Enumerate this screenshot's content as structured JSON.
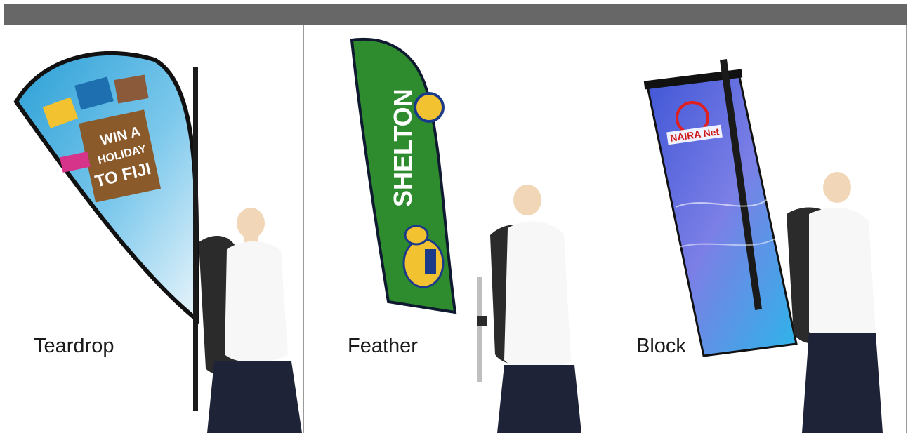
{
  "panels": [
    {
      "caption": "Teardrop"
    },
    {
      "caption": "Feather"
    },
    {
      "caption": "Block"
    }
  ],
  "flags": {
    "teardrop_text": [
      "WIN A",
      "HOLIDAY",
      "TO FIJI"
    ],
    "feather_text": "SHELTON",
    "block_logo": "NAIRA Net"
  },
  "colors": {
    "header_bar": "#676767",
    "divider": "#9a9a9a",
    "feather_green": "#2e8b2e",
    "block_blue": "#3a4fc8"
  }
}
